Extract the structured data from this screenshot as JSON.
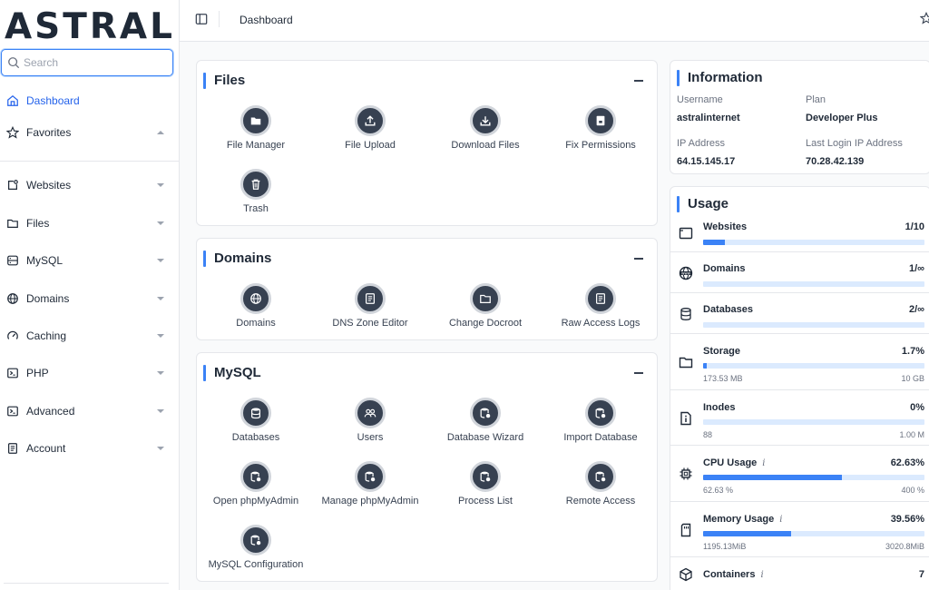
{
  "brand": {
    "logo": "ASTRAL"
  },
  "search": {
    "placeholder": "Search"
  },
  "sidebar": {
    "items": [
      {
        "label": "Dashboard",
        "icon": "home-icon",
        "active": true
      },
      {
        "label": "Favorites",
        "icon": "star-icon",
        "expanded": true
      },
      {
        "label": "Websites",
        "icon": "website-icon"
      },
      {
        "label": "Files",
        "icon": "folder-icon"
      },
      {
        "label": "MySQL",
        "icon": "database-icon"
      },
      {
        "label": "Domains",
        "icon": "globe-icon"
      },
      {
        "label": "Caching",
        "icon": "gauge-icon"
      },
      {
        "label": "PHP",
        "icon": "terminal-icon"
      },
      {
        "label": "Advanced",
        "icon": "terminal-icon"
      },
      {
        "label": "Account",
        "icon": "document-icon"
      }
    ]
  },
  "topbar": {
    "title": "Dashboard"
  },
  "sections": {
    "files": {
      "title": "Files",
      "tiles": [
        "File Manager",
        "File Upload",
        "Download Files",
        "Fix Permissions",
        "Trash"
      ]
    },
    "domains": {
      "title": "Domains",
      "tiles": [
        "Domains",
        "DNS Zone Editor",
        "Change Docroot",
        "Raw Access Logs"
      ]
    },
    "mysql": {
      "title": "MySQL",
      "tiles": [
        "Databases",
        "Users",
        "Database Wizard",
        "Import Database",
        "Open phpMyAdmin",
        "Manage phpMyAdmin",
        "Process List",
        "Remote Access",
        "MySQL Configuration"
      ]
    }
  },
  "information": {
    "title": "Information",
    "username_label": "Username",
    "username": "astralinternet",
    "plan_label": "Plan",
    "plan": "Developer Plus",
    "ip_label": "IP Address",
    "ip": "64.15.145.17",
    "last_ip_label": "Last Login IP Address",
    "last_ip": "70.28.42.139"
  },
  "usage": {
    "title": "Usage",
    "info_marker": "i",
    "rows": [
      {
        "name": "Websites",
        "value": "1/10",
        "fill": 0.1
      },
      {
        "name": "Domains",
        "value": "1/∞",
        "fill": 0
      },
      {
        "name": "Databases",
        "value": "2/∞",
        "fill": 0
      },
      {
        "name": "Storage",
        "value": "1.7%",
        "fill": 0.017,
        "left": "173.53 MB",
        "right": "10 GB"
      },
      {
        "name": "Inodes",
        "value": "0%",
        "fill": 0,
        "left": "88",
        "right": "1.00 M"
      },
      {
        "name": "CPU Usage",
        "value": "62.63%",
        "fill": 0.6263,
        "left": "62.63 %",
        "right": "400 %",
        "info": true
      },
      {
        "name": "Memory Usage",
        "value": "39.56%",
        "fill": 0.3956,
        "left": "1195.13MiB",
        "right": "3020.8MiB",
        "info": true
      },
      {
        "name": "Containers",
        "value": "7",
        "info": true
      }
    ]
  },
  "colors": {
    "accent": "#3b82f6",
    "tile_bg": "#374151",
    "bar_bg": "#dbeafe"
  }
}
